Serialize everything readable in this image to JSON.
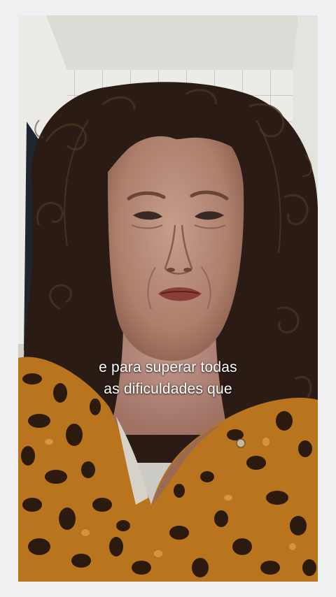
{
  "video": {
    "caption_lines": [
      "e para superar todas",
      "as dificuldades que"
    ],
    "colors": {
      "page_background": "#eef0f2",
      "ceiling": "#dcdbd6",
      "tile_wall": "#e9e9e6",
      "hair": "#2a1c14",
      "skin": "#b88f7e",
      "blouse_base": "#b9741e",
      "blouse_pattern": "#2b1a0d",
      "caption_text": "#ffffff"
    }
  }
}
